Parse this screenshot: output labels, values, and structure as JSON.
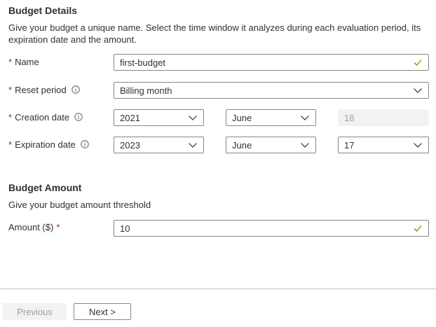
{
  "budget_details": {
    "title": "Budget Details",
    "description": "Give your budget a unique name. Select the time window it analyzes during each evaluation period, its expiration date and the amount."
  },
  "form": {
    "required_marker": "*",
    "name": {
      "label": "Name",
      "value": "first-budget",
      "valid": true
    },
    "reset_period": {
      "label": "Reset period",
      "value": "Billing month"
    },
    "creation_date": {
      "label": "Creation date",
      "year": "2021",
      "month": "June",
      "day": "18"
    },
    "expiration_date": {
      "label": "Expiration date",
      "year": "2023",
      "month": "June",
      "day": "17"
    }
  },
  "budget_amount": {
    "title": "Budget Amount",
    "description": "Give your budget amount threshold",
    "amount": {
      "label": "Amount ($)",
      "value": "10",
      "valid": true
    }
  },
  "footer": {
    "previous_label": "Previous",
    "next_label": "Next >"
  },
  "icons": {
    "info": "info-icon",
    "chevron": "chevron-down-icon",
    "check": "checkmark-icon"
  },
  "colors": {
    "required": "#a4262c",
    "valid": "#57a300",
    "border": "#8a8886",
    "disabled_bg": "#f3f2f1"
  }
}
